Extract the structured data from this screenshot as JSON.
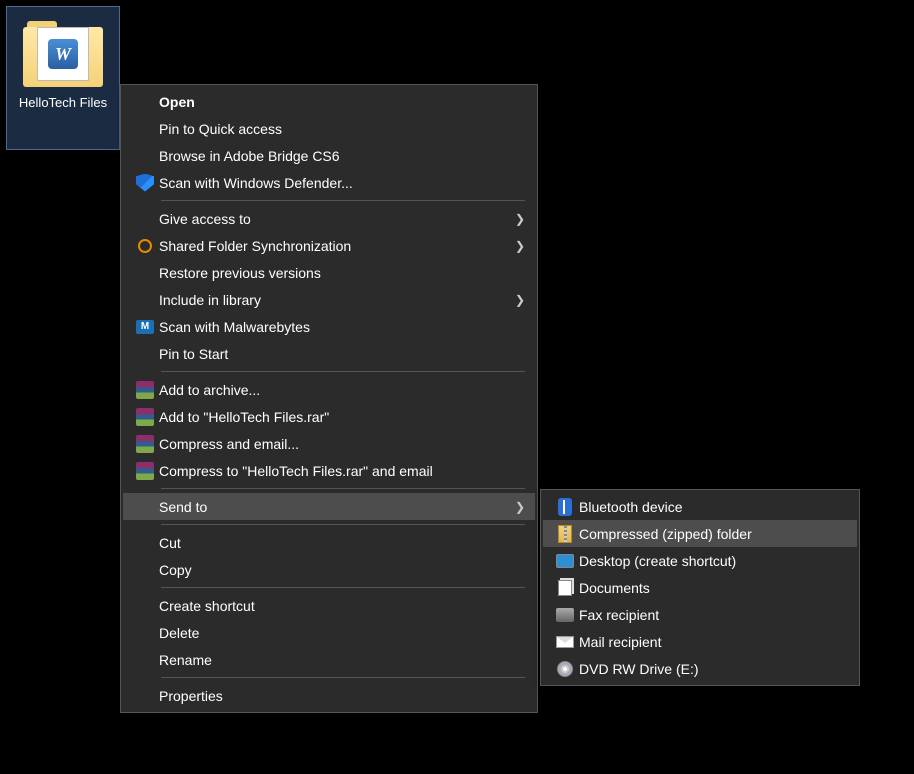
{
  "desktop": {
    "item_label": "HelloTech Files",
    "word_glyph": "W"
  },
  "context_menu": {
    "open": "Open",
    "pin_quick_access": "Pin to Quick access",
    "browse_bridge": "Browse in Adobe Bridge CS6",
    "scan_defender": "Scan with Windows Defender...",
    "give_access": "Give access to",
    "shared_folder_sync": "Shared Folder Synchronization",
    "restore_versions": "Restore previous versions",
    "include_library": "Include in library",
    "scan_malwarebytes": "Scan with Malwarebytes",
    "pin_start": "Pin to Start",
    "add_archive": "Add to archive...",
    "add_rar": "Add to \"HelloTech Files.rar\"",
    "compress_email": "Compress and email...",
    "compress_rar_email": "Compress to \"HelloTech Files.rar\" and email",
    "send_to": "Send to",
    "cut": "Cut",
    "copy": "Copy",
    "create_shortcut": "Create shortcut",
    "delete": "Delete",
    "rename": "Rename",
    "properties": "Properties"
  },
  "send_to_menu": {
    "bluetooth": "Bluetooth device",
    "zipped": "Compressed (zipped) folder",
    "desktop_shortcut": "Desktop (create shortcut)",
    "documents": "Documents",
    "fax": "Fax recipient",
    "mail": "Mail recipient",
    "dvd": "DVD RW Drive (E:)"
  },
  "glyphs": {
    "submenu_arrow": "❯"
  }
}
